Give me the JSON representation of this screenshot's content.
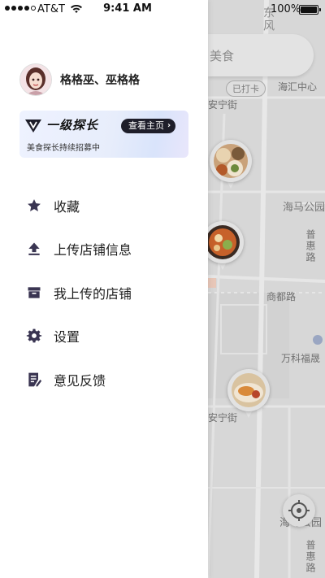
{
  "status_bar": {
    "carrier": "AT&T",
    "time": "9:41 AM",
    "battery": "100%"
  },
  "map": {
    "search_placeholder": "美食",
    "chip_label": "已打卡",
    "labels": {
      "east_wind": "东风",
      "haihui": "海汇中心",
      "anning_street_top": "安宁街",
      "haima_park": "海马公园",
      "puhui_road": "普惠路",
      "shangdu_road": "商都路",
      "vanke": "万科福晟",
      "anning_street_bottom": "安宁街",
      "haima_park_bottom": "海马公园",
      "puhui_road_bottom": "普惠路"
    }
  },
  "profile": {
    "username": "格格巫、巫格格"
  },
  "banner": {
    "title": "一级探长",
    "subtitle": "美食探长持续招募中",
    "button_label": "查看主页"
  },
  "menu": {
    "items": [
      {
        "label": "收藏",
        "icon": "star-icon"
      },
      {
        "label": "上传店铺信息",
        "icon": "upload-icon"
      },
      {
        "label": "我上传的店铺",
        "icon": "store-icon"
      },
      {
        "label": "设置",
        "icon": "gear-icon"
      },
      {
        "label": "意见反馈",
        "icon": "feedback-icon"
      }
    ]
  },
  "colors": {
    "icon": "#3a3552",
    "banner_button": "#1e1e2a",
    "map_bg": "#d7d7d7"
  }
}
